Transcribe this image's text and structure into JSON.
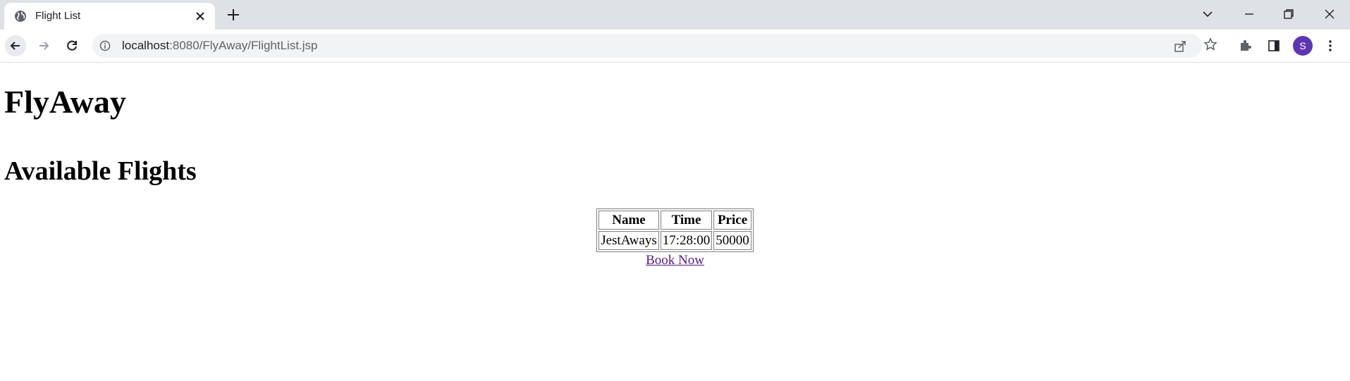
{
  "browser": {
    "tab_title": "Flight List",
    "url_host": "localhost",
    "url_rest": ":8080/FlyAway/FlightList.jsp",
    "avatar_initial": "S",
    "accent": "#5e35b1"
  },
  "page": {
    "site_title": "FlyAway",
    "heading": "Available Flights",
    "table": {
      "headers": [
        "Name",
        "Time",
        "Price"
      ],
      "rows": [
        [
          "JestAways",
          "17:28:00",
          "50000"
        ]
      ]
    },
    "book_link": "Book Now",
    "link_color": "#551a8b"
  }
}
